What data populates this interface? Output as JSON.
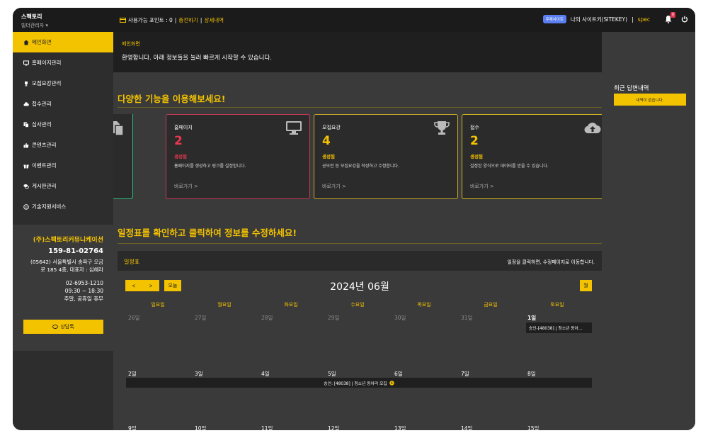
{
  "brand": {
    "title": "스펙토리",
    "subtitle": "빌더관리자 ▾"
  },
  "topbar": {
    "points_label": "사용가능 포인트 : 0",
    "sep1": "|",
    "charge": "충전하기",
    "sep2": "|",
    "detail": "상세내역",
    "badge": "주제사이트",
    "site_name": "나의 사이트키(SITEKEY)",
    "sep3": "|",
    "spec": "spec",
    "bell_count": "0"
  },
  "sidebar": {
    "items": [
      {
        "label": "메인화면",
        "icon": "home-icon",
        "active": true
      },
      {
        "label": "홈페이지관리",
        "icon": "monitor-icon"
      },
      {
        "label": "모집요강관리",
        "icon": "trophy-icon"
      },
      {
        "label": "접수관리",
        "icon": "cloud-upload-icon"
      },
      {
        "label": "심사관리",
        "icon": "copy-icon"
      },
      {
        "label": "콘텐츠관리",
        "icon": "thumbs-up-icon"
      },
      {
        "label": "이벤트관리",
        "icon": "gift-icon"
      },
      {
        "label": "게시판관리",
        "icon": "comments-icon"
      },
      {
        "label": "기술지원서비스",
        "icon": "smile-icon"
      }
    ]
  },
  "company": {
    "name": "(주)스펙토리커뮤니케이션",
    "biz_no": "159-81-02764",
    "addr1": "(05642) 서울특별시 송파구 오금",
    "addr2": "로 185 4층, 대표자 : 심혜라",
    "phone": "02-6953-1210",
    "hours": "09:30 ~ 18:30",
    "holiday": "주말, 공휴일 휴무",
    "consult": "상담톡"
  },
  "main": {
    "crumb": "메인화면",
    "welcome": "환영합니다. 아래 정보들을 눌러 빠르게 시작할 수 있습니다.",
    "features_title": "다양한 기능을 이용해보세요!",
    "calendar_title": "일정표를 확인하고 클릭하여 정보를 수정하세요!"
  },
  "cards": [
    {
      "title": "홈페이지",
      "count": "2",
      "status": "생성됨",
      "desc": "홈페이지를 생성하고 링크를 설정합니다.",
      "go": "바로가기 >",
      "icon": "monitor-icon",
      "color": "#e8384f"
    },
    {
      "title": "모집요강",
      "count": "4",
      "status": "생성됨",
      "desc": "공모전 등 모집요강을 작성하고 수정합니다.",
      "go": "바로가기 >",
      "icon": "trophy-icon",
      "color": "#f4c300"
    },
    {
      "title": "접수",
      "count": "2",
      "status": "생성됨",
      "desc": "설정된 양식으로 데이터를 받을 수 있습니다.",
      "go": "바로가기 >",
      "icon": "cloud-upload-icon",
      "color": "#f4c300"
    }
  ],
  "calendar": {
    "header": "일정표",
    "hint": "일정을 클릭하면, 수정페이지로 이동합니다.",
    "prev": "<",
    "next": ">",
    "today": "오늘",
    "month_btn": "월",
    "month_title": "2024년 06월",
    "weekdays": [
      "일요일",
      "월요일",
      "화요일",
      "수요일",
      "목요일",
      "금요일",
      "토요일"
    ],
    "week1": [
      "26일",
      "27일",
      "28일",
      "29일",
      "30일",
      "31일",
      "1일"
    ],
    "week2": [
      "2일",
      "3일",
      "4일",
      "5일",
      "6일",
      "7일",
      "8일"
    ],
    "week3": [
      "9일",
      "10일",
      "11일",
      "12일",
      "13일",
      "14일",
      "15일"
    ],
    "event1": "승인-[48038] | 청소년 동아...",
    "event2": "승인: [48038] | 청소년 동아리 모집"
  },
  "right_panel": {
    "title": "최근 답변내역",
    "empty": "내역이 없습니다."
  }
}
